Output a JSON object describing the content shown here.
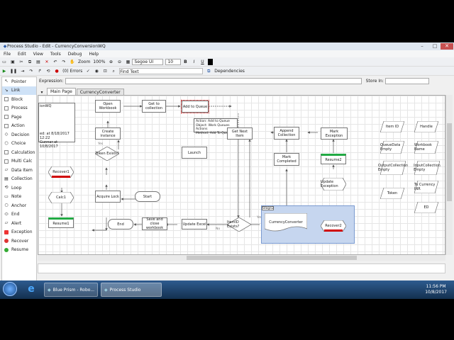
{
  "window": {
    "title": "Process Studio  - Edit - CurrencyConversionWQ",
    "minimize": "–",
    "maximize": "□",
    "close": "✕"
  },
  "menu": [
    "File",
    "Edit",
    "View",
    "Tools",
    "Debug",
    "Help"
  ],
  "toolbar": {
    "zoom_label": "Zoom",
    "zoom_value": "100%",
    "font_name": "Segoe UI",
    "font_size": "10",
    "bold": "B",
    "italic": "I",
    "underline": "U",
    "errors_label": "(0) Errors",
    "find_text": "Find Text",
    "dependencies": "Dependencies"
  },
  "expression": {
    "label": "Expression:",
    "store_in": "Store In:"
  },
  "tools": [
    "Pointer",
    "Link",
    "Block",
    "Process",
    "Page",
    "Action",
    "Decision",
    "Choice",
    "Calculation",
    "Multi Calc",
    "Data Item",
    "Collection",
    "Loop",
    "Note",
    "Anchor",
    "End",
    "Alert",
    "Exception",
    "Recover",
    "Resume"
  ],
  "tabs": [
    "Main Page",
    "CurrencyConverter"
  ],
  "info_box": {
    "name": "ionWQ",
    "line1": "ed: at 8/18/2017 12:22",
    "line2": "Gunnar at 10/8/2017"
  },
  "stages": {
    "open_workbook": "Open Workbook",
    "get_to_collection": "Get to collection",
    "add_to_queue": "Add to Queue",
    "create_instance": "Create instance",
    "token_exists": "Token Exists?",
    "launch": "Launch",
    "recover1": "Recover1",
    "calc1": "Calc1",
    "resume1": "Resume1",
    "acquire_lock": "Acquire Lock",
    "start": "Start",
    "end": "End",
    "save_and_close": "Save and close workbook",
    "update_excel": "Update Excel",
    "itemid_exists": "ItemID Exists?",
    "get_next_item": "Get Next Item",
    "append_collection": "Append Collection",
    "mark_exception": "Mark Exception",
    "mark_completed": "Mark Completed",
    "resume2": "Resume2",
    "update_exception": "Update Exception",
    "recover2": "Recover2",
    "currency_converter": "CurrencyConverter",
    "stage2": "Stage2",
    "yes1": "Yes",
    "yes2": "Yes",
    "no1": "No"
  },
  "tooltip": {
    "line1": "Action: Add to Queue",
    "line2": "Object: Work Queues Actions",
    "line3": "Method: Add To Queue"
  },
  "data_items": [
    "Item ID",
    "Handle",
    "QueueData Empty",
    "Workbook Name",
    "OutputCollection Empty",
    "InputCollection Empty",
    "To Currency INR",
    "Token",
    "ED"
  ],
  "taskbar": {
    "app1": "Blue Prism - Robo...",
    "app2": "Process Studio",
    "time": "11:56 PM",
    "date": "10/8/2017"
  }
}
